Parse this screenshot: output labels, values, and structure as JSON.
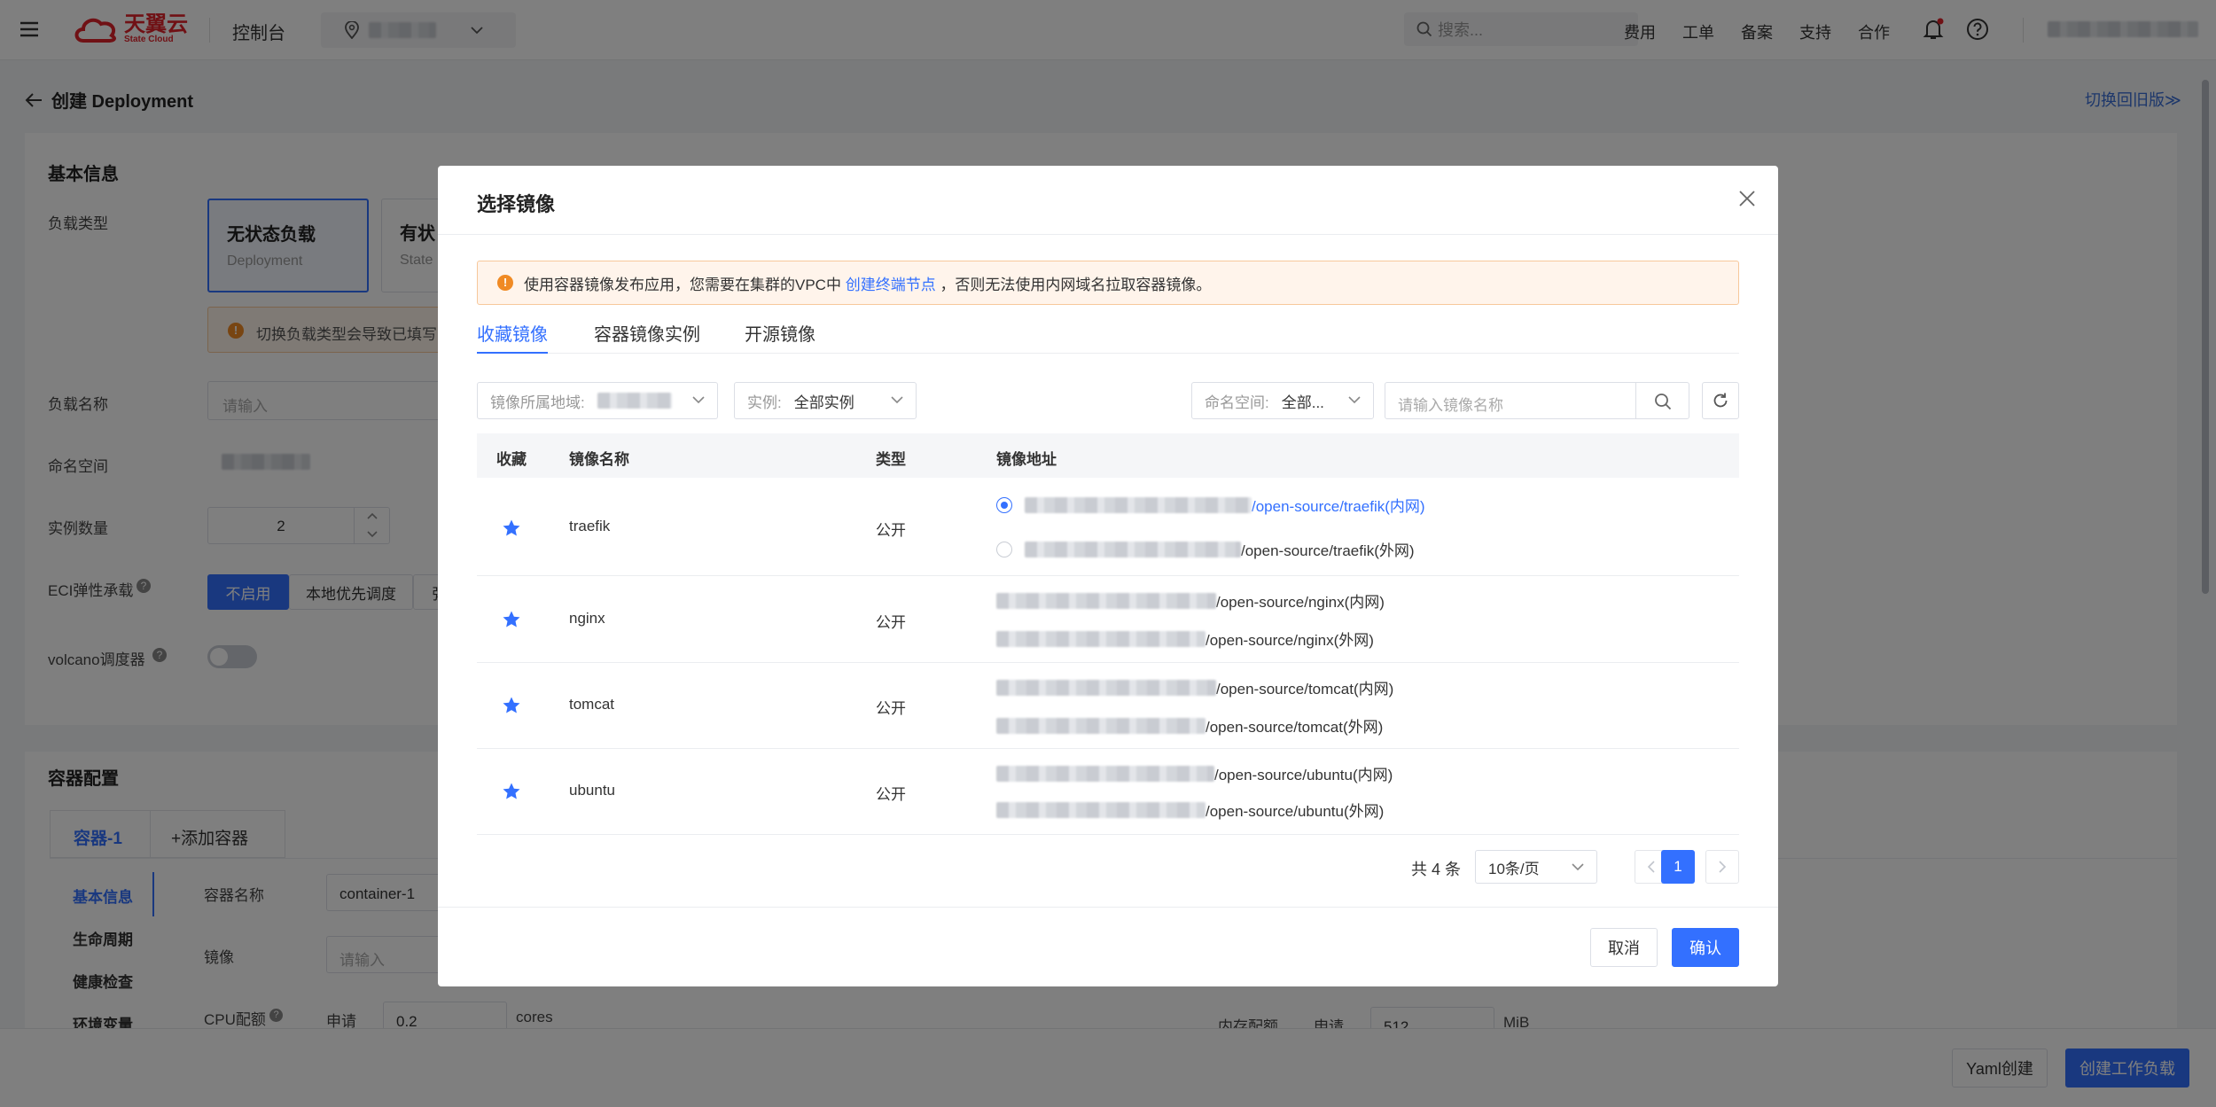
{
  "topbar": {
    "logo_cn": "天翼云",
    "logo_en": "State Cloud",
    "console": "控制台",
    "search_placeholder": "搜索...",
    "nav": [
      "费用",
      "工单",
      "备案",
      "支持",
      "合作"
    ]
  },
  "page": {
    "title": "创建 Deployment",
    "switch_old": "切换回旧版≫",
    "basic_info": "基本信息",
    "workload_type_label": "负载类型",
    "stateless_title": "无状态负载",
    "stateless_sub": "Deployment",
    "stateful_title": "有状",
    "stateful_sub": "State",
    "warn_text": "切换负载类型会导致已填写的",
    "workload_name_label": "负载名称",
    "workload_name_placeholder": "请输入",
    "namespace_label": "命名空间",
    "replicas_label": "实例数量",
    "replicas_value": "2",
    "eci_label": "ECI弹性承载",
    "eci_opt1": "不启用",
    "eci_opt2": "本地优先调度",
    "eci_opt3": "弹",
    "volcano_label": "volcano调度器",
    "container_config": "容器配置",
    "container_tab": "容器-1",
    "add_container": "+添加容器",
    "side_nav": [
      "基本信息",
      "生命周期",
      "健康检查",
      "环境变量"
    ],
    "container_name_label": "容器名称",
    "container_name_value": "container-1",
    "image_label": "镜像",
    "image_placeholder": "请输入",
    "cpu_label": "CPU配额",
    "cpu_request_label": "申请",
    "cpu_request_value": "0.2",
    "cpu_unit": "cores",
    "mem_label": "内存配额",
    "mem_request_label": "申请",
    "mem_request_value": "512",
    "mem_unit": "MiB"
  },
  "footer": {
    "yaml_button": "Yaml创建",
    "create_button": "创建工作负载"
  },
  "modal": {
    "title": "选择镜像",
    "alert_pre": "使用容器镜像发布应用，您需要在集群的VPC中",
    "alert_link": "创建终端节点",
    "alert_post": "，否则无法使用内网域名拉取容器镜像。",
    "tabs": [
      "收藏镜像",
      "容器镜像实例",
      "开源镜像"
    ],
    "filters": {
      "region_label": "镜像所属地域:",
      "instance_label": "实例:",
      "instance_value": "全部实例",
      "namespace_label": "命名空间:",
      "namespace_value": "全部...",
      "name_placeholder": "请输入镜像名称"
    },
    "columns": [
      "收藏",
      "镜像名称",
      "类型",
      "镜像地址"
    ],
    "rows": [
      {
        "name": "traefik",
        "type": "公开",
        "inner": "/open-source/traefik(内网)",
        "outer": "/open-source/traefik(外网)"
      },
      {
        "name": "nginx",
        "type": "公开",
        "inner": "/open-source/nginx(内网)",
        "outer": "/open-source/nginx(外网)"
      },
      {
        "name": "tomcat",
        "type": "公开",
        "inner": "/open-source/tomcat(内网)",
        "outer": "/open-source/tomcat(外网)"
      },
      {
        "name": "ubuntu",
        "type": "公开",
        "inner": "/open-source/ubuntu(内网)",
        "outer": "/open-source/ubuntu(外网)"
      }
    ],
    "pager": {
      "total": "共 4 条",
      "page_size": "10条/页",
      "current": "1"
    },
    "cancel": "取消",
    "confirm": "确认"
  },
  "colors": {
    "primary": "#3370ff",
    "logo_red": "#e0232b",
    "alert_bg": "#fff4eb",
    "alert_icon": "#f08a24"
  }
}
